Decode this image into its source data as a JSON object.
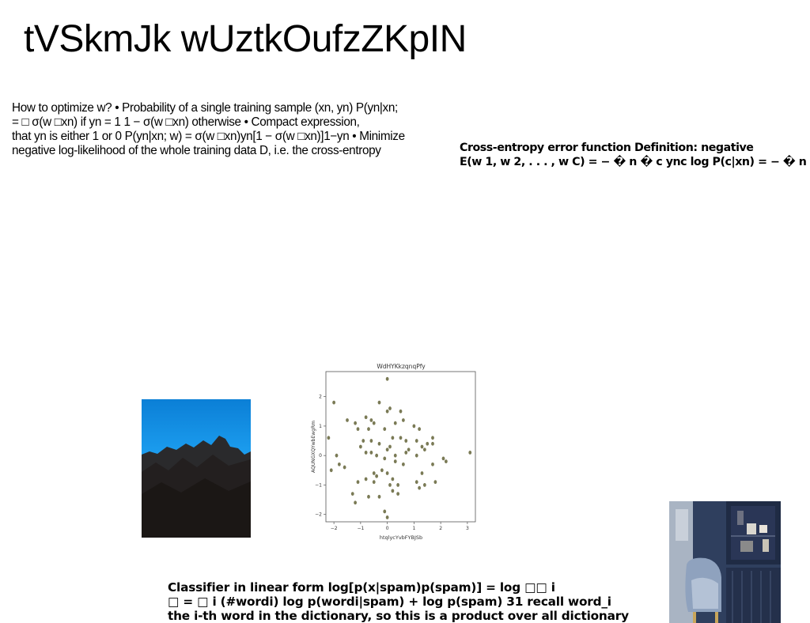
{
  "title": "tVSkmJk wUztkOufzZKpIN",
  "paragraph": {
    "lines": [
      "How to optimize w? • Probability of a single training sample (xn, yn) P(yn|xn;",
      "= □ σ(w □xn) if yn = 1 1 − σ(w □xn) otherwise • Compact expression,",
      "that yn is either 1 or 0 P(yn|xn; w) = σ(w □xn)yn[1 − σ(w □xn)]1−yn • Minimize",
      "negative log-likelihood of the whole training data D, i.e. the cross-entropy"
    ]
  },
  "cross_entropy": {
    "lines": [
      "Cross-entropy error function Definition: negative",
      "E(w 1, w 2, . . . , w C) = − � n � c ync log P(c|xn) = − � n"
    ]
  },
  "classifier": {
    "lines": [
      "Classifier in linear form log[p(x|spam)p(spam)] = log □□ i",
      "□ = □ i (#wordi) log p(wordi|spam) + log p(spam) 31 recall word_i",
      "the i-th word in the dictionary, so this is a product over all dictionary"
    ]
  },
  "chart_data": {
    "type": "scatter",
    "title": "WdHYKkzqnqPfy",
    "xlabel": "htqlycYvbFYBJSb",
    "ylabel": "AQUNGXQYwbEwgRm",
    "xlim": [
      -2.3,
      3.3
    ],
    "ylim": [
      -2.25,
      2.85
    ],
    "xticks": [
      -2,
      -1,
      0,
      1,
      2,
      3
    ],
    "yticks": [
      -2,
      -1,
      0,
      1,
      2
    ],
    "grid": false,
    "color": "#7a7a55",
    "points": [
      [
        -2.0,
        1.8
      ],
      [
        -1.9,
        0.0
      ],
      [
        -2.1,
        -0.5
      ],
      [
        -1.8,
        -0.3
      ],
      [
        -1.6,
        -0.4
      ],
      [
        -1.5,
        1.2
      ],
      [
        -1.3,
        -1.3
      ],
      [
        -1.2,
        -1.6
      ],
      [
        -1.2,
        1.1
      ],
      [
        -1.1,
        0.9
      ],
      [
        -1.1,
        -0.9
      ],
      [
        -1.0,
        0.3
      ],
      [
        -0.9,
        0.5
      ],
      [
        -0.8,
        1.3
      ],
      [
        -0.8,
        0.1
      ],
      [
        -0.8,
        -0.8
      ],
      [
        -0.7,
        0.9
      ],
      [
        -0.7,
        -1.4
      ],
      [
        -0.6,
        1.2
      ],
      [
        -0.6,
        0.5
      ],
      [
        -0.5,
        1.1
      ],
      [
        -0.5,
        -0.6
      ],
      [
        -0.5,
        -0.9
      ],
      [
        -0.4,
        0.0
      ],
      [
        -0.4,
        -0.7
      ],
      [
        -0.3,
        1.8
      ],
      [
        -0.3,
        -1.4
      ],
      [
        -0.3,
        0.4
      ],
      [
        -0.2,
        -0.5
      ],
      [
        -0.1,
        0.9
      ],
      [
        -0.1,
        -0.1
      ],
      [
        -0.1,
        -1.9
      ],
      [
        0.0,
        1.5
      ],
      [
        0.0,
        0.2
      ],
      [
        0.0,
        -0.6
      ],
      [
        0.0,
        -2.1
      ],
      [
        0.0,
        2.6
      ],
      [
        0.1,
        1.6
      ],
      [
        0.1,
        0.3
      ],
      [
        0.1,
        -1.0
      ],
      [
        0.2,
        0.6
      ],
      [
        0.2,
        -0.8
      ],
      [
        0.2,
        -1.2
      ],
      [
        0.3,
        1.1
      ],
      [
        0.3,
        0.0
      ],
      [
        0.3,
        -0.2
      ],
      [
        0.4,
        -1.0
      ],
      [
        0.4,
        -1.3
      ],
      [
        0.5,
        0.6
      ],
      [
        0.5,
        1.5
      ],
      [
        0.6,
        -0.3
      ],
      [
        0.6,
        1.2
      ],
      [
        0.7,
        0.5
      ],
      [
        0.7,
        0.1
      ],
      [
        0.8,
        0.2
      ],
      [
        1.0,
        1.0
      ],
      [
        1.1,
        0.5
      ],
      [
        1.1,
        0.0
      ],
      [
        1.1,
        -0.9
      ],
      [
        1.2,
        0.9
      ],
      [
        1.2,
        -1.1
      ],
      [
        1.3,
        0.3
      ],
      [
        1.3,
        -0.6
      ],
      [
        1.4,
        -1.0
      ],
      [
        1.4,
        0.2
      ],
      [
        1.5,
        0.4
      ],
      [
        1.7,
        0.4
      ],
      [
        1.7,
        0.6
      ],
      [
        1.7,
        -0.3
      ],
      [
        1.8,
        -0.9
      ],
      [
        2.1,
        -0.1
      ],
      [
        2.2,
        -0.2
      ],
      [
        3.1,
        0.1
      ],
      [
        -2.2,
        0.6
      ],
      [
        -0.6,
        0.1
      ]
    ]
  }
}
